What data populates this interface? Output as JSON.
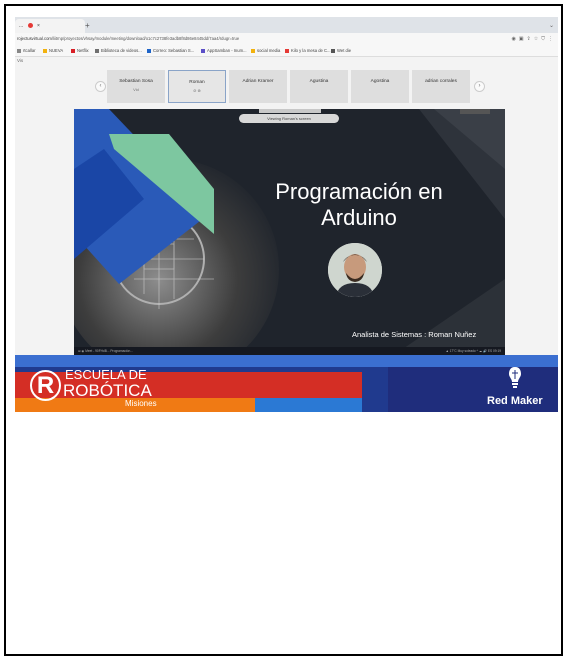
{
  "browser": {
    "tab_title": "...",
    "tab_close": "×",
    "new_tab": "+",
    "url_host": "rojectusvirtual.com",
    "url_path": "/liitrnp/proyectos/vhsay/module/meeting/download/o1c7c2738fe3adb8f8d86e8445dd/7aa4/rdugr=true",
    "bookmarks": [
      {
        "label": "rtcallar",
        "color": "#888888"
      },
      {
        "label": "NUEVA",
        "color": "#f2b20e"
      },
      {
        "label": "Netflix",
        "color": "#d81f26"
      },
      {
        "label": "Biblioteca de videos...",
        "color": "#6f6f6f"
      },
      {
        "label": "Correo: Sebastian S...",
        "color": "#1e64c8"
      },
      {
        "label": "AppSamban - Inum...",
        "color": "#5b4fc7"
      },
      {
        "label": "social media",
        "color": "#f2b20e"
      },
      {
        "label": "Kilo y la mesa de C...",
        "color": "#e53935"
      },
      {
        "label": "Wet die",
        "color": "#555555"
      }
    ],
    "view_label": "Vis"
  },
  "participants": {
    "prev": "‹",
    "next": "›",
    "items": [
      {
        "name": "Sebastian Sosa",
        "sub": "Vid",
        "active": false
      },
      {
        "name": "Roman",
        "sub": "⊘ ⊗",
        "active": true
      },
      {
        "name": "Adrian Kramer",
        "sub": "",
        "active": false
      },
      {
        "name": "Agustina",
        "sub": "",
        "active": false
      },
      {
        "name": "Agostina",
        "sub": "",
        "active": false
      },
      {
        "name": "adrian corrales",
        "sub": "",
        "active": false
      }
    ]
  },
  "shared_screen": {
    "viewing_banner": "Viewing Roman's screen",
    "title_line1": "Programación en",
    "title_line2": "Arduino",
    "presenter": "Analista de Sistemas : Roman Nuñez",
    "taskbar_left": "⊞  ◉  Meet - 90FHdB...  Programación...",
    "taskbar_right": "▲ 17°C  Muy soleado  ^  ☁ 🔊 ES  09:19"
  },
  "branding": {
    "logo_letter": "R",
    "escuela": "ESCUELA DE",
    "robotica": "ROBÓTICA",
    "misiones": "Misiones",
    "redmaker": "Red Maker",
    "colors": {
      "red": "#d42e25",
      "orange": "#f07a14",
      "navy": "#1f2d7c",
      "blue": "#2b79d4"
    }
  }
}
